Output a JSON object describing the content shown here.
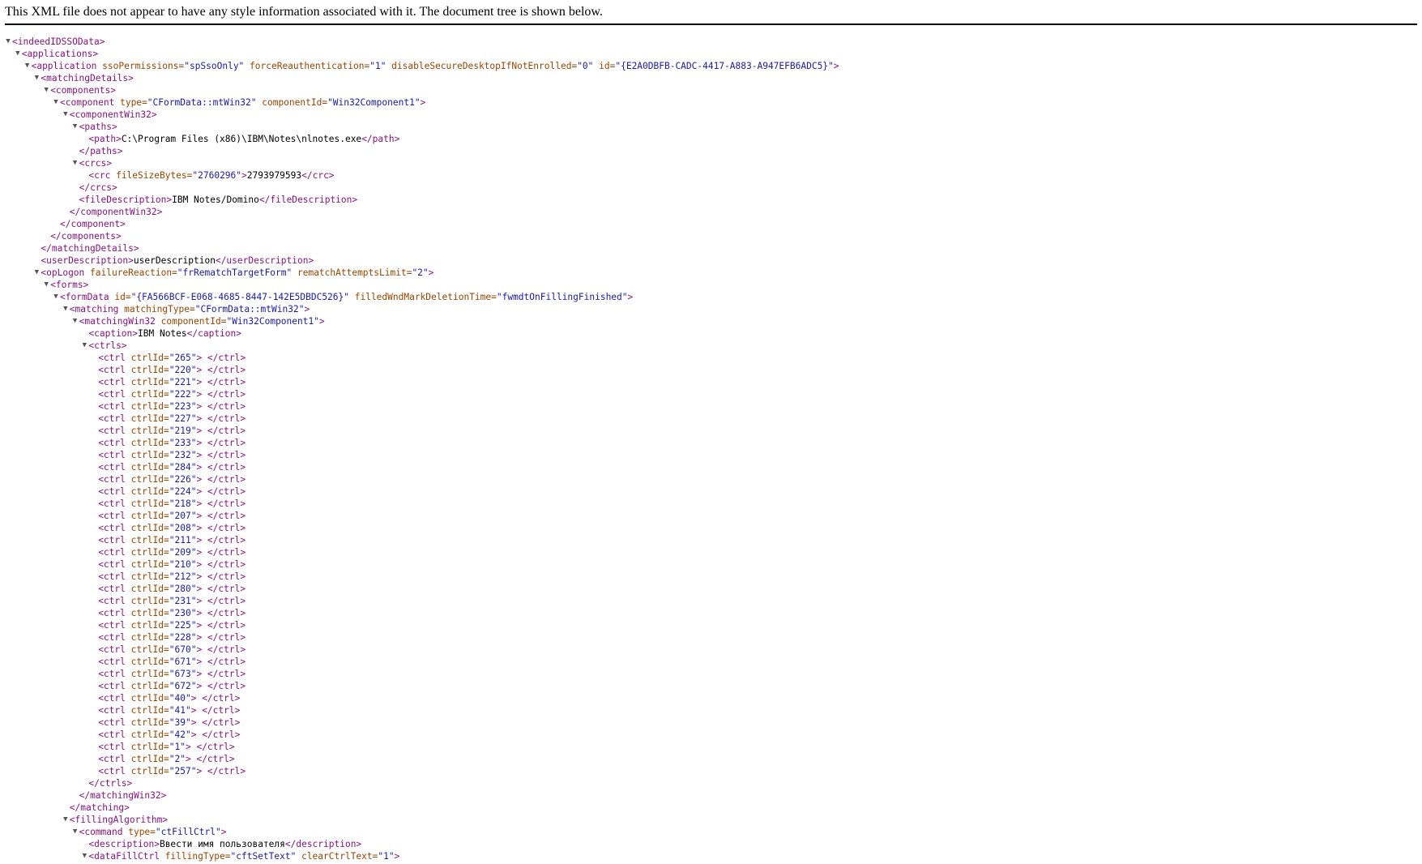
{
  "notice": "This XML file does not appear to have any style information associated with it. The document tree is shown below.",
  "colors": {
    "tag": "#881280",
    "attr_name": "#994500",
    "attr_value": "#1a1aa6",
    "text": "#000000"
  },
  "toggle_icon": "▼",
  "lines": [
    {
      "d": 0,
      "t": 1,
      "p": [
        [
          "g",
          "<indeedIDSSOData>"
        ]
      ]
    },
    {
      "d": 1,
      "t": 1,
      "p": [
        [
          "g",
          "<applications>"
        ]
      ]
    },
    {
      "d": 2,
      "t": 1,
      "p": [
        [
          "g",
          "<application"
        ],
        [
          "n",
          " ssoPermissions="
        ],
        [
          "v",
          "\"spSsoOnly\""
        ],
        [
          "n",
          " forceReauthentication="
        ],
        [
          "v",
          "\"1\""
        ],
        [
          "n",
          " disableSecureDesktopIfNotEnrolled="
        ],
        [
          "v",
          "\"0\""
        ],
        [
          "n",
          " id="
        ],
        [
          "v",
          "\"{E2A0DBFB-CADC-4417-A883-A947EFB6ADC5}\""
        ],
        [
          "g",
          ">"
        ]
      ]
    },
    {
      "d": 3,
      "t": 1,
      "p": [
        [
          "g",
          "<matchingDetails>"
        ]
      ]
    },
    {
      "d": 4,
      "t": 1,
      "p": [
        [
          "g",
          "<components>"
        ]
      ]
    },
    {
      "d": 5,
      "t": 1,
      "p": [
        [
          "g",
          "<component"
        ],
        [
          "n",
          " type="
        ],
        [
          "v",
          "\"CFormData::mtWin32\""
        ],
        [
          "n",
          " componentId="
        ],
        [
          "v",
          "\"Win32Component1\""
        ],
        [
          "g",
          ">"
        ]
      ]
    },
    {
      "d": 6,
      "t": 1,
      "p": [
        [
          "g",
          "<componentWin32>"
        ]
      ]
    },
    {
      "d": 7,
      "t": 1,
      "p": [
        [
          "g",
          "<paths>"
        ]
      ]
    },
    {
      "d": 8,
      "t": 0,
      "p": [
        [
          "g",
          "<path>"
        ],
        [
          "x",
          "C:\\Program Files (x86)\\IBM\\Notes\\nlnotes.exe"
        ],
        [
          "g",
          "</path>"
        ]
      ]
    },
    {
      "d": 7,
      "t": 0,
      "p": [
        [
          "g",
          "</paths>"
        ]
      ]
    },
    {
      "d": 7,
      "t": 1,
      "p": [
        [
          "g",
          "<crcs>"
        ]
      ]
    },
    {
      "d": 8,
      "t": 0,
      "p": [
        [
          "g",
          "<crc"
        ],
        [
          "n",
          " fileSizeBytes="
        ],
        [
          "v",
          "\"2760296\""
        ],
        [
          "g",
          ">"
        ],
        [
          "x",
          "2793979593"
        ],
        [
          "g",
          "</crc>"
        ]
      ]
    },
    {
      "d": 7,
      "t": 0,
      "p": [
        [
          "g",
          "</crcs>"
        ]
      ]
    },
    {
      "d": 7,
      "t": 0,
      "p": [
        [
          "g",
          "<fileDescription>"
        ],
        [
          "x",
          "IBM Notes/Domino"
        ],
        [
          "g",
          "</fileDescription>"
        ]
      ]
    },
    {
      "d": 6,
      "t": 0,
      "p": [
        [
          "g",
          "</componentWin32>"
        ]
      ]
    },
    {
      "d": 5,
      "t": 0,
      "p": [
        [
          "g",
          "</component>"
        ]
      ]
    },
    {
      "d": 4,
      "t": 0,
      "p": [
        [
          "g",
          "</components>"
        ]
      ]
    },
    {
      "d": 3,
      "t": 0,
      "p": [
        [
          "g",
          "</matchingDetails>"
        ]
      ]
    },
    {
      "d": 3,
      "t": 0,
      "p": [
        [
          "g",
          "<userDescription>"
        ],
        [
          "x",
          "userDescription"
        ],
        [
          "g",
          "</userDescription>"
        ]
      ]
    },
    {
      "d": 3,
      "t": 1,
      "p": [
        [
          "g",
          "<opLogon"
        ],
        [
          "n",
          " failureReaction="
        ],
        [
          "v",
          "\"frRematchTargetForm\""
        ],
        [
          "n",
          " rematchAttemptsLimit="
        ],
        [
          "v",
          "\"2\""
        ],
        [
          "g",
          ">"
        ]
      ]
    },
    {
      "d": 4,
      "t": 1,
      "p": [
        [
          "g",
          "<forms>"
        ]
      ]
    },
    {
      "d": 5,
      "t": 1,
      "p": [
        [
          "g",
          "<formData"
        ],
        [
          "n",
          " id="
        ],
        [
          "v",
          "\"{FA566BCF-E068-4685-8447-142E5DBDC526}\""
        ],
        [
          "n",
          " filledWndMarkDeletionTime="
        ],
        [
          "v",
          "\"fwmdtOnFillingFinished\""
        ],
        [
          "g",
          ">"
        ]
      ]
    },
    {
      "d": 6,
      "t": 1,
      "p": [
        [
          "g",
          "<matching"
        ],
        [
          "n",
          " matchingType="
        ],
        [
          "v",
          "\"CFormData::mtWin32\""
        ],
        [
          "g",
          ">"
        ]
      ]
    },
    {
      "d": 7,
      "t": 1,
      "p": [
        [
          "g",
          "<matchingWin32"
        ],
        [
          "n",
          " componentId="
        ],
        [
          "v",
          "\"Win32Component1\""
        ],
        [
          "g",
          ">"
        ]
      ]
    },
    {
      "d": 8,
      "t": 0,
      "p": [
        [
          "g",
          "<caption>"
        ],
        [
          "x",
          "IBM Notes"
        ],
        [
          "g",
          "</caption>"
        ]
      ]
    },
    {
      "d": 8,
      "t": 1,
      "p": [
        [
          "g",
          "<ctrls>"
        ]
      ]
    },
    {
      "d": 9,
      "t": 0,
      "p": [
        [
          "g",
          "<ctrl"
        ],
        [
          "n",
          " ctrlId="
        ],
        [
          "v",
          "\"265\""
        ],
        [
          "g",
          "> </ctrl>"
        ]
      ]
    },
    {
      "d": 9,
      "t": 0,
      "p": [
        [
          "g",
          "<ctrl"
        ],
        [
          "n",
          " ctrlId="
        ],
        [
          "v",
          "\"220\""
        ],
        [
          "g",
          "> </ctrl>"
        ]
      ]
    },
    {
      "d": 9,
      "t": 0,
      "p": [
        [
          "g",
          "<ctrl"
        ],
        [
          "n",
          " ctrlId="
        ],
        [
          "v",
          "\"221\""
        ],
        [
          "g",
          "> </ctrl>"
        ]
      ]
    },
    {
      "d": 9,
      "t": 0,
      "p": [
        [
          "g",
          "<ctrl"
        ],
        [
          "n",
          " ctrlId="
        ],
        [
          "v",
          "\"222\""
        ],
        [
          "g",
          "> </ctrl>"
        ]
      ]
    },
    {
      "d": 9,
      "t": 0,
      "p": [
        [
          "g",
          "<ctrl"
        ],
        [
          "n",
          " ctrlId="
        ],
        [
          "v",
          "\"223\""
        ],
        [
          "g",
          "> </ctrl>"
        ]
      ]
    },
    {
      "d": 9,
      "t": 0,
      "p": [
        [
          "g",
          "<ctrl"
        ],
        [
          "n",
          " ctrlId="
        ],
        [
          "v",
          "\"227\""
        ],
        [
          "g",
          "> </ctrl>"
        ]
      ]
    },
    {
      "d": 9,
      "t": 0,
      "p": [
        [
          "g",
          "<ctrl"
        ],
        [
          "n",
          " ctrlId="
        ],
        [
          "v",
          "\"219\""
        ],
        [
          "g",
          "> </ctrl>"
        ]
      ]
    },
    {
      "d": 9,
      "t": 0,
      "p": [
        [
          "g",
          "<ctrl"
        ],
        [
          "n",
          " ctrlId="
        ],
        [
          "v",
          "\"233\""
        ],
        [
          "g",
          "> </ctrl>"
        ]
      ]
    },
    {
      "d": 9,
      "t": 0,
      "p": [
        [
          "g",
          "<ctrl"
        ],
        [
          "n",
          " ctrlId="
        ],
        [
          "v",
          "\"232\""
        ],
        [
          "g",
          "> </ctrl>"
        ]
      ]
    },
    {
      "d": 9,
      "t": 0,
      "p": [
        [
          "g",
          "<ctrl"
        ],
        [
          "n",
          " ctrlId="
        ],
        [
          "v",
          "\"284\""
        ],
        [
          "g",
          "> </ctrl>"
        ]
      ]
    },
    {
      "d": 9,
      "t": 0,
      "p": [
        [
          "g",
          "<ctrl"
        ],
        [
          "n",
          " ctrlId="
        ],
        [
          "v",
          "\"226\""
        ],
        [
          "g",
          "> </ctrl>"
        ]
      ]
    },
    {
      "d": 9,
      "t": 0,
      "p": [
        [
          "g",
          "<ctrl"
        ],
        [
          "n",
          " ctrlId="
        ],
        [
          "v",
          "\"224\""
        ],
        [
          "g",
          "> </ctrl>"
        ]
      ]
    },
    {
      "d": 9,
      "t": 0,
      "p": [
        [
          "g",
          "<ctrl"
        ],
        [
          "n",
          " ctrlId="
        ],
        [
          "v",
          "\"218\""
        ],
        [
          "g",
          "> </ctrl>"
        ]
      ]
    },
    {
      "d": 9,
      "t": 0,
      "p": [
        [
          "g",
          "<ctrl"
        ],
        [
          "n",
          " ctrlId="
        ],
        [
          "v",
          "\"207\""
        ],
        [
          "g",
          "> </ctrl>"
        ]
      ]
    },
    {
      "d": 9,
      "t": 0,
      "p": [
        [
          "g",
          "<ctrl"
        ],
        [
          "n",
          " ctrlId="
        ],
        [
          "v",
          "\"208\""
        ],
        [
          "g",
          "> </ctrl>"
        ]
      ]
    },
    {
      "d": 9,
      "t": 0,
      "p": [
        [
          "g",
          "<ctrl"
        ],
        [
          "n",
          " ctrlId="
        ],
        [
          "v",
          "\"211\""
        ],
        [
          "g",
          "> </ctrl>"
        ]
      ]
    },
    {
      "d": 9,
      "t": 0,
      "p": [
        [
          "g",
          "<ctrl"
        ],
        [
          "n",
          " ctrlId="
        ],
        [
          "v",
          "\"209\""
        ],
        [
          "g",
          "> </ctrl>"
        ]
      ]
    },
    {
      "d": 9,
      "t": 0,
      "p": [
        [
          "g",
          "<ctrl"
        ],
        [
          "n",
          " ctrlId="
        ],
        [
          "v",
          "\"210\""
        ],
        [
          "g",
          "> </ctrl>"
        ]
      ]
    },
    {
      "d": 9,
      "t": 0,
      "p": [
        [
          "g",
          "<ctrl"
        ],
        [
          "n",
          " ctrlId="
        ],
        [
          "v",
          "\"212\""
        ],
        [
          "g",
          "> </ctrl>"
        ]
      ]
    },
    {
      "d": 9,
      "t": 0,
      "p": [
        [
          "g",
          "<ctrl"
        ],
        [
          "n",
          " ctrlId="
        ],
        [
          "v",
          "\"280\""
        ],
        [
          "g",
          "> </ctrl>"
        ]
      ]
    },
    {
      "d": 9,
      "t": 0,
      "p": [
        [
          "g",
          "<ctrl"
        ],
        [
          "n",
          " ctrlId="
        ],
        [
          "v",
          "\"231\""
        ],
        [
          "g",
          "> </ctrl>"
        ]
      ]
    },
    {
      "d": 9,
      "t": 0,
      "p": [
        [
          "g",
          "<ctrl"
        ],
        [
          "n",
          " ctrlId="
        ],
        [
          "v",
          "\"230\""
        ],
        [
          "g",
          "> </ctrl>"
        ]
      ]
    },
    {
      "d": 9,
      "t": 0,
      "p": [
        [
          "g",
          "<ctrl"
        ],
        [
          "n",
          " ctrlId="
        ],
        [
          "v",
          "\"225\""
        ],
        [
          "g",
          "> </ctrl>"
        ]
      ]
    },
    {
      "d": 9,
      "t": 0,
      "p": [
        [
          "g",
          "<ctrl"
        ],
        [
          "n",
          " ctrlId="
        ],
        [
          "v",
          "\"228\""
        ],
        [
          "g",
          "> </ctrl>"
        ]
      ]
    },
    {
      "d": 9,
      "t": 0,
      "p": [
        [
          "g",
          "<ctrl"
        ],
        [
          "n",
          " ctrlId="
        ],
        [
          "v",
          "\"670\""
        ],
        [
          "g",
          "> </ctrl>"
        ]
      ]
    },
    {
      "d": 9,
      "t": 0,
      "p": [
        [
          "g",
          "<ctrl"
        ],
        [
          "n",
          " ctrlId="
        ],
        [
          "v",
          "\"671\""
        ],
        [
          "g",
          "> </ctrl>"
        ]
      ]
    },
    {
      "d": 9,
      "t": 0,
      "p": [
        [
          "g",
          "<ctrl"
        ],
        [
          "n",
          " ctrlId="
        ],
        [
          "v",
          "\"673\""
        ],
        [
          "g",
          "> </ctrl>"
        ]
      ]
    },
    {
      "d": 9,
      "t": 0,
      "p": [
        [
          "g",
          "<ctrl"
        ],
        [
          "n",
          " ctrlId="
        ],
        [
          "v",
          "\"672\""
        ],
        [
          "g",
          "> </ctrl>"
        ]
      ]
    },
    {
      "d": 9,
      "t": 0,
      "p": [
        [
          "g",
          "<ctrl"
        ],
        [
          "n",
          " ctrlId="
        ],
        [
          "v",
          "\"40\""
        ],
        [
          "g",
          "> </ctrl>"
        ]
      ]
    },
    {
      "d": 9,
      "t": 0,
      "p": [
        [
          "g",
          "<ctrl"
        ],
        [
          "n",
          " ctrlId="
        ],
        [
          "v",
          "\"41\""
        ],
        [
          "g",
          "> </ctrl>"
        ]
      ]
    },
    {
      "d": 9,
      "t": 0,
      "p": [
        [
          "g",
          "<ctrl"
        ],
        [
          "n",
          " ctrlId="
        ],
        [
          "v",
          "\"39\""
        ],
        [
          "g",
          "> </ctrl>"
        ]
      ]
    },
    {
      "d": 9,
      "t": 0,
      "p": [
        [
          "g",
          "<ctrl"
        ],
        [
          "n",
          " ctrlId="
        ],
        [
          "v",
          "\"42\""
        ],
        [
          "g",
          "> </ctrl>"
        ]
      ]
    },
    {
      "d": 9,
      "t": 0,
      "p": [
        [
          "g",
          "<ctrl"
        ],
        [
          "n",
          " ctrlId="
        ],
        [
          "v",
          "\"1\""
        ],
        [
          "g",
          "> </ctrl>"
        ]
      ]
    },
    {
      "d": 9,
      "t": 0,
      "p": [
        [
          "g",
          "<ctrl"
        ],
        [
          "n",
          " ctrlId="
        ],
        [
          "v",
          "\"2\""
        ],
        [
          "g",
          "> </ctrl>"
        ]
      ]
    },
    {
      "d": 9,
      "t": 0,
      "p": [
        [
          "g",
          "<ctrl"
        ],
        [
          "n",
          " ctrlId="
        ],
        [
          "v",
          "\"257\""
        ],
        [
          "g",
          "> </ctrl>"
        ]
      ]
    },
    {
      "d": 8,
      "t": 0,
      "p": [
        [
          "g",
          "</ctrls>"
        ]
      ]
    },
    {
      "d": 7,
      "t": 0,
      "p": [
        [
          "g",
          "</matchingWin32>"
        ]
      ]
    },
    {
      "d": 6,
      "t": 0,
      "p": [
        [
          "g",
          "</matching>"
        ]
      ]
    },
    {
      "d": 6,
      "t": 1,
      "p": [
        [
          "g",
          "<fillingAlgorithm>"
        ]
      ]
    },
    {
      "d": 7,
      "t": 1,
      "p": [
        [
          "g",
          "<command"
        ],
        [
          "n",
          " type="
        ],
        [
          "v",
          "\"ctFillCtrl\""
        ],
        [
          "g",
          ">"
        ]
      ]
    },
    {
      "d": 8,
      "t": 0,
      "p": [
        [
          "g",
          "<description>"
        ],
        [
          "x",
          "Ввести имя пользователя"
        ],
        [
          "g",
          "</description>"
        ]
      ]
    },
    {
      "d": 8,
      "t": 1,
      "p": [
        [
          "g",
          "<dataFillCtrl"
        ],
        [
          "n",
          " fillingType="
        ],
        [
          "v",
          "\"cftSetText\""
        ],
        [
          "n",
          " clearCtrlText="
        ],
        [
          "v",
          "\"1\""
        ],
        [
          "g",
          ">"
        ]
      ]
    }
  ]
}
